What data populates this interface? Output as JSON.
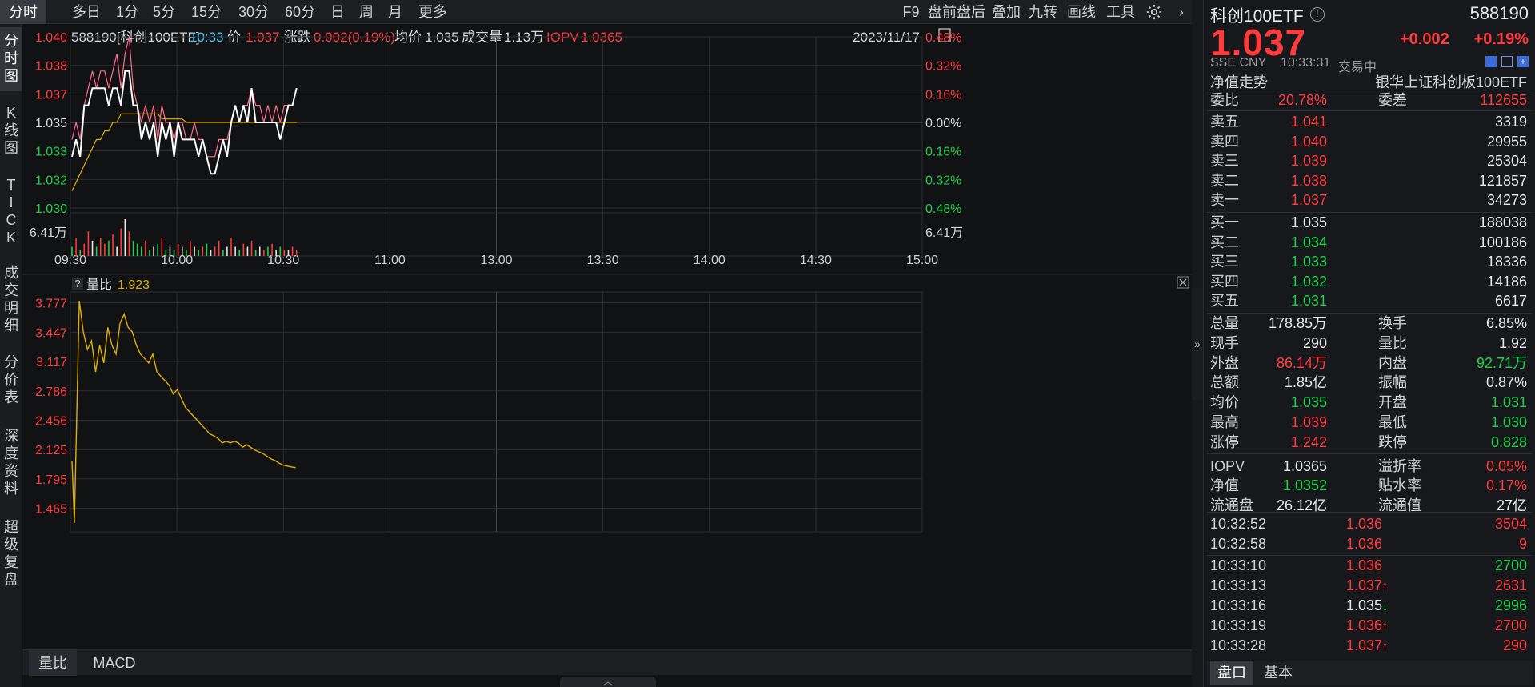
{
  "toolbar": {
    "periods": [
      "分时",
      "多日",
      "1分",
      "5分",
      "15分",
      "30分",
      "60分",
      "日",
      "周",
      "月",
      "更多"
    ],
    "tools": [
      "F9",
      "盘前盘后",
      "叠加",
      "九转",
      "画线",
      "工具"
    ],
    "gear_icon": "gear-icon",
    "collapse_icon": "chevron-right-icon"
  },
  "left_tabs": [
    "分时图",
    "K线图",
    "TICK",
    "成交明细",
    "分价表",
    "深度资料",
    "超级复盘"
  ],
  "info_bar": {
    "code_name": "588190[科创100ETF]",
    "time": "10:33",
    "price_label": "价",
    "price": "1.037",
    "change_label": "涨跌",
    "change": "0.002(0.19%)",
    "avg_label": "均价",
    "avg": "1.035",
    "volume_label": "成交量",
    "volume": "1.13万",
    "iopv_label": "IOPV",
    "iopv": "1.0365",
    "date": "2023/11/17"
  },
  "chart_data": [
    {
      "type": "line",
      "price_ticks_left": [
        "1.040",
        "1.038",
        "1.037",
        "1.035",
        "1.033",
        "1.032",
        "1.030"
      ],
      "pct_ticks_right": [
        "0.48%",
        "0.32%",
        "0.16%",
        "0.00%",
        "0.16%",
        "0.32%",
        "0.48%"
      ],
      "volume_label": "6.41万",
      "time_ticks": [
        "09:30",
        "10:00",
        "10:30",
        "11:00",
        "13:00",
        "13:30",
        "14:00",
        "14:30",
        "15:00"
      ],
      "prev_close": 1.035,
      "ylim": [
        1.03,
        1.04
      ],
      "series": [
        {
          "color": "#ffffff",
          "values": [
            1.033,
            1.034,
            1.033,
            1.036,
            1.036,
            1.037,
            1.037,
            1.037,
            1.037,
            1.036,
            1.037,
            1.037,
            1.036,
            1.038,
            1.038,
            1.036,
            1.036,
            1.034,
            1.035,
            1.034,
            1.035,
            1.033,
            1.035,
            1.034,
            1.035,
            1.033,
            1.035,
            1.034,
            1.034,
            1.034,
            1.034,
            1.033,
            1.034,
            1.033,
            1.032,
            1.032,
            1.033,
            1.034,
            1.033,
            1.035,
            1.036,
            1.035,
            1.036,
            1.035,
            1.037,
            1.035,
            1.035,
            1.035,
            1.035,
            1.035,
            1.035,
            1.034,
            1.035,
            1.036,
            1.036,
            1.037
          ]
        },
        {
          "color": "#ff6b8a",
          "values": [
            1.034,
            1.035,
            1.034,
            1.036,
            1.037,
            1.038,
            1.037,
            1.038,
            1.038,
            1.037,
            1.038,
            1.039,
            1.037,
            1.039,
            1.04,
            1.037,
            1.036,
            1.035,
            1.036,
            1.035,
            1.036,
            1.034,
            1.036,
            1.035,
            1.035,
            1.034,
            1.035,
            1.035,
            1.034,
            1.034,
            1.035,
            1.034,
            1.034,
            1.033,
            1.033,
            1.033,
            1.034,
            1.034,
            1.034,
            1.035,
            1.036,
            1.035,
            1.036,
            1.036,
            1.037,
            1.036,
            1.036,
            1.035,
            1.036,
            1.035,
            1.036,
            1.035,
            1.036,
            1.036,
            1.036,
            1.037
          ]
        },
        {
          "color": "#e0b000",
          "values": [
            1.031,
            1.0315,
            1.032,
            1.0325,
            1.033,
            1.0335,
            1.034,
            1.034,
            1.0345,
            1.0345,
            1.035,
            1.035,
            1.0355,
            1.0355,
            1.0355,
            1.0355,
            1.0355,
            1.0355,
            1.0355,
            1.0355,
            1.0355,
            1.0355,
            1.0352,
            1.0352,
            1.0352,
            1.0352,
            1.0352,
            1.0352,
            1.035,
            1.035,
            1.035,
            1.035,
            1.035,
            1.035,
            1.035,
            1.035,
            1.035,
            1.035,
            1.035,
            1.035,
            1.035,
            1.035,
            1.035,
            1.035,
            1.035,
            1.035,
            1.035,
            1.035,
            1.035,
            1.035,
            1.035,
            1.035,
            1.035,
            1.035,
            1.035,
            1.035
          ]
        }
      ],
      "volumes": [
        0.3,
        0.6,
        0.2,
        0.4,
        0.8,
        0.5,
        0.3,
        0.6,
        0.4,
        0.5,
        0.7,
        0.3,
        0.9,
        1.2,
        0.8,
        0.5,
        0.4,
        0.3,
        0.5,
        0.2,
        0.3,
        0.4,
        0.6,
        0.2,
        0.3,
        0.2,
        0.4,
        0.3,
        0.2,
        0.5,
        0.3,
        0.2,
        0.3,
        0.4,
        0.2,
        0.3,
        0.5,
        0.2,
        0.3,
        0.6,
        0.3,
        0.2,
        0.4,
        0.3,
        0.5,
        0.2,
        0.3,
        0.2,
        0.3,
        0.4,
        0.2,
        0.3,
        0.2,
        0.2,
        0.3,
        0.2
      ],
      "volume_colors": [
        "green",
        "red",
        "green",
        "red",
        "red",
        "white",
        "green",
        "red",
        "red",
        "green",
        "red",
        "white",
        "red",
        "white",
        "red",
        "green",
        "green",
        "green",
        "red",
        "green",
        "white",
        "green",
        "red",
        "green",
        "white",
        "green",
        "red",
        "white",
        "green",
        "red",
        "white",
        "green",
        "red",
        "green",
        "white",
        "red",
        "red",
        "green",
        "white",
        "red",
        "white",
        "green",
        "red",
        "white",
        "red",
        "green",
        "white",
        "red",
        "green",
        "red",
        "white",
        "green",
        "red",
        "white",
        "red",
        "red"
      ]
    },
    {
      "type": "line",
      "title": "量比",
      "value_label": "1.923",
      "ticks": [
        "3.777",
        "3.447",
        "3.117",
        "2.786",
        "2.456",
        "2.125",
        "1.795",
        "1.465"
      ],
      "ylim": [
        1.2,
        3.9
      ],
      "series": [
        {
          "color": "#e0b000",
          "values": [
            2.0,
            1.3,
            3.8,
            3.45,
            3.25,
            3.35,
            3.0,
            3.3,
            3.1,
            3.5,
            3.3,
            3.2,
            3.55,
            3.65,
            3.5,
            3.45,
            3.3,
            3.2,
            3.15,
            3.1,
            3.2,
            3.0,
            2.95,
            2.9,
            2.85,
            2.75,
            2.8,
            2.7,
            2.6,
            2.55,
            2.5,
            2.45,
            2.4,
            2.35,
            2.3,
            2.28,
            2.25,
            2.2,
            2.22,
            2.2,
            2.22,
            2.2,
            2.15,
            2.18,
            2.15,
            2.12,
            2.1,
            2.08,
            2.05,
            2.02,
            2.0,
            1.97,
            1.95,
            1.94,
            1.93,
            1.923
          ]
        }
      ]
    }
  ],
  "lower_panel": {
    "question": "?",
    "label": "量比",
    "value": "1.923"
  },
  "bottom_tabs": [
    "量比",
    "MACD"
  ],
  "right_panel": {
    "name": "科创100ETF",
    "code": "588190",
    "price": "1.037",
    "change": "+0.002",
    "change_pct": "+0.19%",
    "market": "SSE CNY",
    "time": "10:33:31",
    "status": "交易中",
    "nav_trend_label": "净值走势",
    "index_name": "银华上证科创板100ETF",
    "weibi_label": "委比",
    "weibi": "20.78%",
    "weicha_label": "委差",
    "weicha": "112655",
    "asks": [
      {
        "label": "卖五",
        "price": "1.041",
        "vol": "3319"
      },
      {
        "label": "卖四",
        "price": "1.040",
        "vol": "29955"
      },
      {
        "label": "卖三",
        "price": "1.039",
        "vol": "25304"
      },
      {
        "label": "卖二",
        "price": "1.038",
        "vol": "121857"
      },
      {
        "label": "卖一",
        "price": "1.037",
        "vol": "34273"
      }
    ],
    "bids": [
      {
        "label": "买一",
        "price": "1.035",
        "vol": "188038"
      },
      {
        "label": "买二",
        "price": "1.034",
        "vol": "100186"
      },
      {
        "label": "买三",
        "price": "1.033",
        "vol": "18336"
      },
      {
        "label": "买四",
        "price": "1.032",
        "vol": "14186"
      },
      {
        "label": "买五",
        "price": "1.031",
        "vol": "6617"
      }
    ],
    "stats": [
      {
        "l1": "总量",
        "v1": "178.85万",
        "c1": "white",
        "l2": "换手",
        "v2": "6.85%",
        "c2": "white"
      },
      {
        "l1": "现手",
        "v1": "290",
        "c1": "white",
        "l2": "量比",
        "v2": "1.92",
        "c2": "white"
      },
      {
        "l1": "外盘",
        "v1": "86.14万",
        "c1": "red",
        "l2": "内盘",
        "v2": "92.71万",
        "c2": "green"
      },
      {
        "l1": "总额",
        "v1": "1.85亿",
        "c1": "white",
        "l2": "振幅",
        "v2": "0.87%",
        "c2": "white"
      },
      {
        "l1": "均价",
        "v1": "1.035",
        "c1": "green",
        "l2": "开盘",
        "v2": "1.031",
        "c2": "green"
      },
      {
        "l1": "最高",
        "v1": "1.039",
        "c1": "red",
        "l2": "最低",
        "v2": "1.030",
        "c2": "green"
      },
      {
        "l1": "涨停",
        "v1": "1.242",
        "c1": "red",
        "l2": "跌停",
        "v2": "0.828",
        "c2": "green"
      },
      {
        "l1": "IOPV",
        "v1": "1.0365",
        "c1": "white",
        "l2": "溢折率",
        "v2": "0.05%",
        "c2": "red"
      },
      {
        "l1": "净值",
        "v1": "1.0352",
        "c1": "green",
        "l2": "贴水率",
        "v2": "0.17%",
        "c2": "red"
      },
      {
        "l1": "流通盘",
        "v1": "26.12亿",
        "c1": "white",
        "l2": "流通值",
        "v2": "27亿",
        "c2": "white"
      }
    ],
    "ticks": [
      {
        "time": "10:32:52",
        "price": "1.036",
        "pc": "red",
        "arrow": "",
        "vol": "3504",
        "vc": "red"
      },
      {
        "time": "10:32:58",
        "price": "1.036",
        "pc": "red",
        "arrow": "",
        "vol": "9",
        "vc": "red"
      },
      {
        "time": "10:33:10",
        "price": "1.036",
        "pc": "red",
        "arrow": "",
        "vol": "2700",
        "vc": "green"
      },
      {
        "time": "10:33:13",
        "price": "1.037",
        "pc": "red",
        "arrow": "🡑",
        "vol": "2631",
        "vc": "red"
      },
      {
        "time": "10:33:16",
        "price": "1.035",
        "pc": "white",
        "arrow": "🡓",
        "vol": "2996",
        "vc": "green"
      },
      {
        "time": "10:33:19",
        "price": "1.036",
        "pc": "red",
        "arrow": "🡑",
        "vol": "2700",
        "vc": "red"
      },
      {
        "time": "10:33:28",
        "price": "1.037",
        "pc": "red",
        "arrow": "🡑",
        "vol": "290",
        "vc": "red"
      }
    ],
    "tabs": [
      "盘口",
      "基本"
    ]
  }
}
